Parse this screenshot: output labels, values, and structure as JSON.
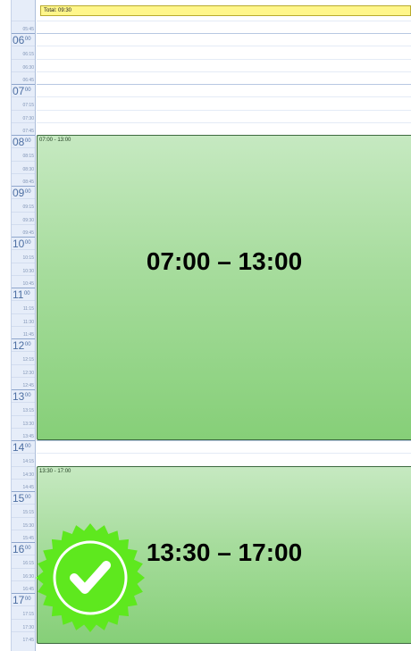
{
  "total_label": "Total: 09:30",
  "hours": [
    {
      "hour": "06",
      "minutes": [
        "06:15",
        "06:30",
        "06:45"
      ]
    },
    {
      "hour": "07",
      "minutes": [
        "07:15",
        "07:30",
        "07:45"
      ]
    },
    {
      "hour": "08",
      "minutes": [
        "08:15",
        "08:30",
        "08:45"
      ]
    },
    {
      "hour": "09",
      "minutes": [
        "09:15",
        "09:30",
        "09:45"
      ]
    },
    {
      "hour": "10",
      "minutes": [
        "10:15",
        "10:30",
        "10:45"
      ]
    },
    {
      "hour": "11",
      "minutes": [
        "11:15",
        "11:30",
        "11:45"
      ]
    },
    {
      "hour": "12",
      "minutes": [
        "12:15",
        "12:30",
        "12:45"
      ]
    },
    {
      "hour": "13",
      "minutes": [
        "13:15",
        "13:30",
        "13:45"
      ]
    },
    {
      "hour": "14",
      "minutes": [
        "14:15",
        "14:30",
        "14:45"
      ]
    },
    {
      "hour": "15",
      "minutes": [
        "15:15",
        "15:30",
        "15:45"
      ]
    },
    {
      "hour": "16",
      "minutes": [
        "16:15",
        "16:30",
        "16:45"
      ]
    },
    {
      "hour": "17",
      "minutes": [
        "17:15",
        "17:30",
        "17:45"
      ]
    }
  ],
  "first_minute_label": "05:45",
  "hour_suffix": "00",
  "shifts": [
    {
      "small_label": "07:00 - 13:00",
      "big_label": "07:00 – 13:00"
    },
    {
      "small_label": "13:30 - 17:00",
      "big_label": "13:30 – 17:00"
    }
  ],
  "colors": {
    "shift_top": "#c6e9c1",
    "shift_bottom": "#86cf78",
    "total_bar": "#fff68a",
    "badge": "#5ee81e"
  },
  "badge_icon": "verified-check-icon"
}
